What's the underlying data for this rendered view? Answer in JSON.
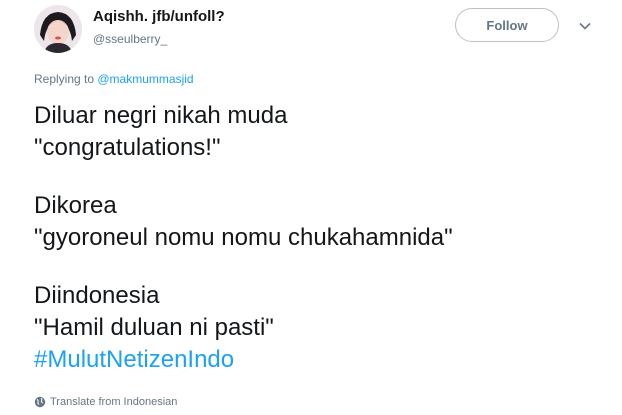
{
  "header": {
    "display_name": "Aqishh. jfb/unfoll?",
    "handle": "@sseulberry_",
    "follow_label": "Follow",
    "avatar_icon": "avatar-icon",
    "caret_icon": "chevron-down-icon"
  },
  "reply": {
    "prefix": "Replying to ",
    "mention": "@makmummasjid"
  },
  "tweet": {
    "lines": [
      "Diluar negri nikah muda",
      "\"congratulations!\"",
      "Dikorea",
      "\"gyoroneul nomu nomu chukahamnida\"",
      "Diindonesia",
      "\"Hamil duluan ni pasti\""
    ],
    "hashtag": "#MulutNetizenIndo"
  },
  "footer": {
    "translate_label": "Translate from Indonesian",
    "translate_icon": "globe-icon"
  },
  "colors": {
    "accent": "#1da1f2",
    "text": "#14171a",
    "secondary": "#657786",
    "button_border": "#b7c3cc"
  }
}
